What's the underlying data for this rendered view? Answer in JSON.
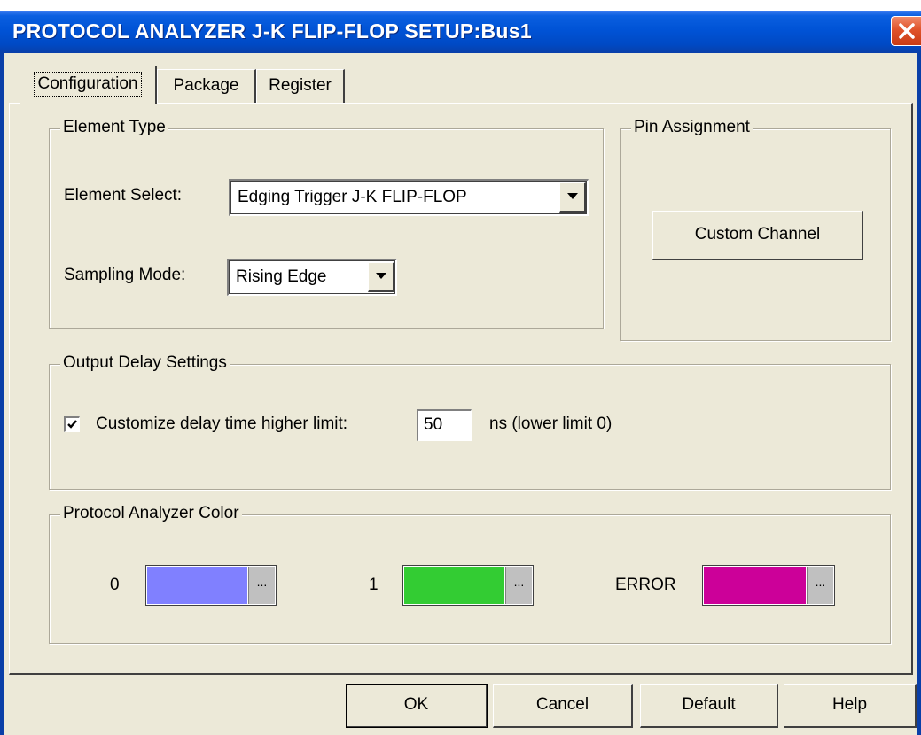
{
  "window": {
    "title": "PROTOCOL ANALYZER J-K FLIP-FLOP SETUP:Bus1"
  },
  "tabs": [
    {
      "label": "Configuration",
      "active": true
    },
    {
      "label": "Package",
      "active": false
    },
    {
      "label": "Register",
      "active": false
    }
  ],
  "element_type": {
    "legend": "Element Type",
    "element_select_label": "Element Select:",
    "element_select_value": "Edging Trigger J-K FLIP-FLOP",
    "sampling_mode_label": "Sampling Mode:",
    "sampling_mode_value": "Rising Edge"
  },
  "pin_assignment": {
    "legend": "Pin Assignment",
    "custom_channel_label": "Custom Channel"
  },
  "output_delay": {
    "legend": "Output Delay Settings",
    "checkbox_label": "Customize delay time higher limit:",
    "checked": true,
    "value": "50",
    "unit_text": "ns (lower limit 0)"
  },
  "protocol_color": {
    "legend": "Protocol Analyzer Color",
    "items": [
      {
        "label": "0",
        "color": "#8080ff"
      },
      {
        "label": "1",
        "color": "#33cc33"
      },
      {
        "label": "ERROR",
        "color": "#cc0099"
      }
    ],
    "more_label": "..."
  },
  "buttons": {
    "ok": "OK",
    "cancel": "Cancel",
    "default": "Default",
    "help": "Help"
  },
  "icons": {
    "close": "close-icon",
    "dropdown": "chevron-down-icon",
    "check": "checkmark-icon"
  },
  "colors": {
    "titlebar": "#0053d6",
    "dialog_bg": "#ece9d8",
    "close_button": "#e0532a"
  }
}
